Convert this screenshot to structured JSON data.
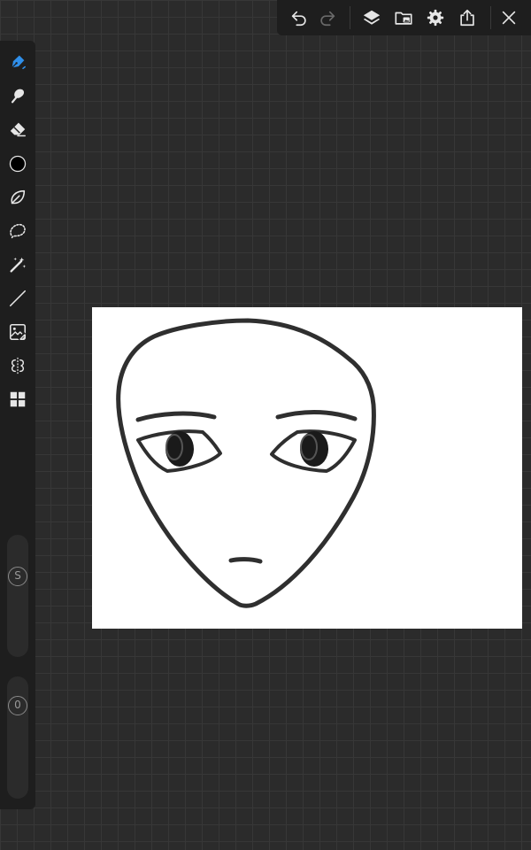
{
  "toolbar": {
    "undo": {
      "icon": "undo-icon"
    },
    "redo": {
      "icon": "redo-icon",
      "enabled": false
    },
    "layers": {
      "icon": "layers-icon"
    },
    "import": {
      "icon": "folder-image-icon"
    },
    "settings": {
      "icon": "gear-icon"
    },
    "export": {
      "icon": "share-icon"
    },
    "close": {
      "icon": "close-icon"
    }
  },
  "tools": [
    {
      "name": "pen",
      "icon": "pen-icon",
      "active": true
    },
    {
      "name": "smudge",
      "icon": "smudge-icon",
      "active": false
    },
    {
      "name": "eraser",
      "icon": "eraser-icon",
      "active": false
    },
    {
      "name": "color",
      "icon": "color-swatch-icon",
      "active": false
    },
    {
      "name": "fill",
      "icon": "leaf-fill-icon",
      "active": false
    },
    {
      "name": "lasso",
      "icon": "lasso-icon",
      "active": false
    },
    {
      "name": "magic-wand",
      "icon": "magic-wand-icon",
      "active": false
    },
    {
      "name": "line",
      "icon": "line-icon",
      "active": false
    },
    {
      "name": "image-transform",
      "icon": "image-transform-icon",
      "active": false
    },
    {
      "name": "symmetry",
      "icon": "symmetry-icon",
      "active": false
    },
    {
      "name": "more",
      "icon": "grid-icon",
      "active": false
    }
  ],
  "sliders": {
    "size": {
      "label": "S"
    },
    "opacity": {
      "label": "0"
    }
  },
  "colors": {
    "accent": "#2f8fea",
    "current_color": "#000000",
    "icon": "#e6e6e6",
    "icon_disabled": "#6a6a6a"
  }
}
